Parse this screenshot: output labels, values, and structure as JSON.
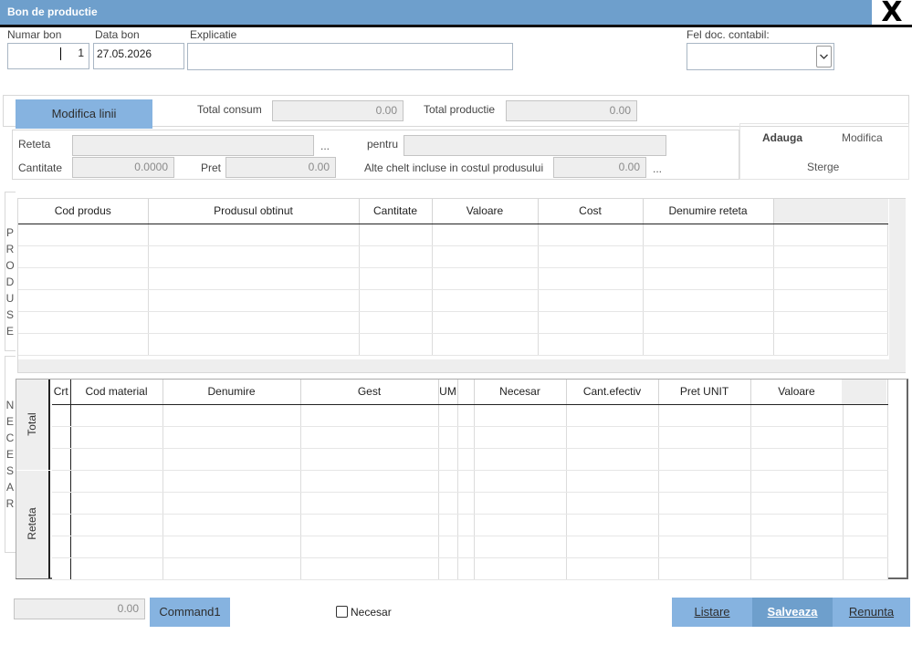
{
  "window": {
    "title": "Bon de productie",
    "close_label": "X"
  },
  "header": {
    "numar_bon_label": "Numar bon",
    "numar_bon_value": "1",
    "data_bon_label": "Data bon",
    "data_bon_value": "27.05.2026",
    "explicatie_label": "Explicatie",
    "explicatie_value": "",
    "fel_doc_label": "Fel doc. contabil:",
    "fel_doc_value": ""
  },
  "summary": {
    "modifica_linii_label": "Modifica linii",
    "total_consum_label": "Total consum",
    "total_consum_value": "0.00",
    "total_productie_label": "Total productie",
    "total_productie_value": "0.00"
  },
  "recipe": {
    "reteta_label": "Reteta",
    "reteta_value": "",
    "reteta_ellipsis": "...",
    "pentru_label": "pentru",
    "pentru_value": "",
    "cantitate_label": "Cantitate",
    "cantitate_value": "0.0000",
    "pret_label": "Pret",
    "pret_value": "0.00",
    "alte_label": "Alte chelt incluse in costul produsului",
    "alte_value": "0.00",
    "alte_ellipsis": "...",
    "adauga_label": "Adauga",
    "modifica_label": "Modifica",
    "sterge_label": "Sterge"
  },
  "produse": {
    "side_letters": [
      "P",
      "R",
      "O",
      "D",
      "U",
      "S",
      "E"
    ],
    "columns": [
      "Cod produs",
      "Produsul obtinut",
      "Cantitate",
      "Valoare",
      "Cost",
      "Denumire reteta",
      ""
    ],
    "rows": [
      [
        "",
        "",
        "",
        "",
        "",
        "",
        ""
      ],
      [
        "",
        "",
        "",
        "",
        "",
        "",
        ""
      ],
      [
        "",
        "",
        "",
        "",
        "",
        "",
        ""
      ],
      [
        "",
        "",
        "",
        "",
        "",
        "",
        ""
      ],
      [
        "",
        "",
        "",
        "",
        "",
        "",
        ""
      ],
      [
        "",
        "",
        "",
        "",
        "",
        "",
        ""
      ]
    ]
  },
  "necesar": {
    "side_letters": [
      "N",
      "E",
      "C",
      "E",
      "S",
      "A",
      "R"
    ],
    "tab_total": "Total",
    "tab_reteta": "Reteta",
    "columns": [
      "Crt",
      "Cod material",
      "Denumire",
      "Gest",
      "UM",
      "",
      "Necesar",
      "Cant.efectiv",
      "Pret UNIT",
      "Valoare",
      ""
    ],
    "rows": [
      [
        "",
        "",
        "",
        "",
        "",
        "",
        "",
        "",
        "",
        "",
        ""
      ],
      [
        "",
        "",
        "",
        "",
        "",
        "",
        "",
        "",
        "",
        "",
        ""
      ],
      [
        "",
        "",
        "",
        "",
        "",
        "",
        "",
        "",
        "",
        "",
        ""
      ],
      [
        "",
        "",
        "",
        "",
        "",
        "",
        "",
        "",
        "",
        "",
        ""
      ],
      [
        "",
        "",
        "",
        "",
        "",
        "",
        "",
        "",
        "",
        "",
        ""
      ],
      [
        "",
        "",
        "",
        "",
        "",
        "",
        "",
        "",
        "",
        "",
        ""
      ],
      [
        "",
        "",
        "",
        "",
        "",
        "",
        "",
        "",
        "",
        "",
        ""
      ],
      [
        "",
        "",
        "",
        "",
        "",
        "",
        "",
        "",
        "",
        "",
        ""
      ]
    ]
  },
  "footer": {
    "amount_value": "0.00",
    "command1_label": "Command1",
    "necesar_checkbox_label": "Necesar",
    "listare_label": "Listare",
    "salveaza_label": "Salveaza",
    "renunta_label": "Renunta"
  },
  "colors": {
    "titlebar": "#6e9fcc",
    "button": "#86b3e0",
    "button_active": "#6e9fcc"
  }
}
